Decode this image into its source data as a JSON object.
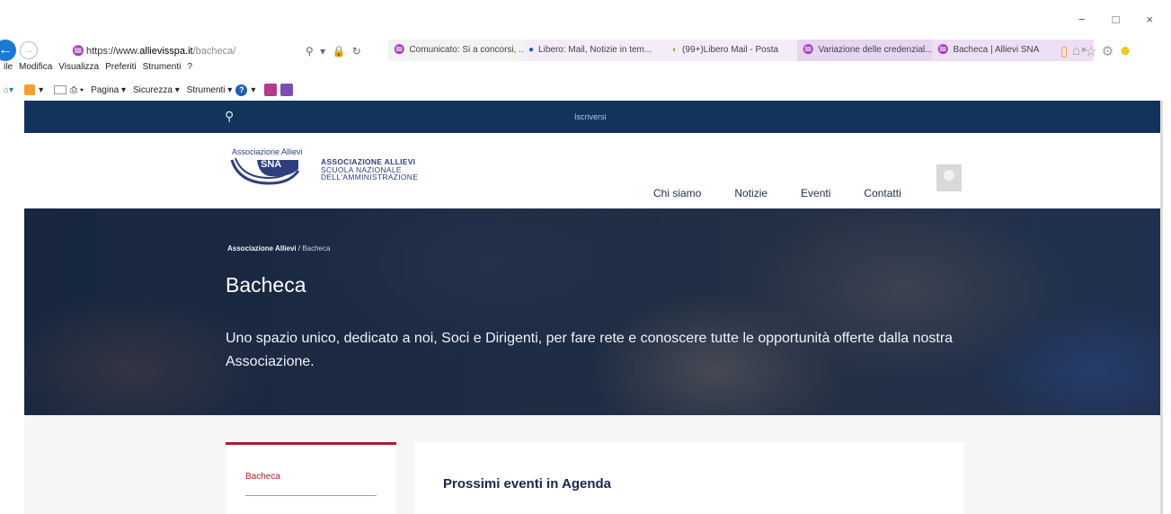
{
  "browser": {
    "address": {
      "prefix": "https://www.",
      "domain": "allievisspa.it",
      "path": "/bacheca/"
    },
    "address_tools": "⚲ ▾ 🔒 ↻",
    "tabs": [
      {
        "label": "Comunicato: Si a concorsi, ..."
      },
      {
        "label": "Libero: Mail, Notizie in tem..."
      },
      {
        "label": "(99+)Libero Mail - Posta"
      },
      {
        "label": "Variazione delle credenzial..."
      },
      {
        "label": "Bacheca | Allievi SNA"
      }
    ],
    "tab_close": "×",
    "menu": [
      "ile",
      "Modifica",
      "Visualizza",
      "Preferiti",
      "Strumenti",
      "?"
    ],
    "commands": [
      "Pagina ▾",
      "Sicurezza ▾",
      "Strumenti ▾"
    ],
    "window_controls": [
      "−",
      "□",
      "×"
    ],
    "right_icons": [
      "home-icon",
      "star-icon",
      "gear-icon",
      "smiley-icon"
    ]
  },
  "site": {
    "topbar": {
      "signup": "Iscriversi"
    },
    "logo": {
      "top_text": "Associazione Allievi",
      "badge": "SNA"
    },
    "org": {
      "line1": "ASSOCIAZIONE ALLIEVI",
      "line2": "SCUOLA NAZIONALE",
      "line3": "DELL'AMMINISTRAZIONE"
    },
    "nav": [
      "Chi siamo",
      "Notizie",
      "Eventi",
      "Contatti"
    ],
    "hero": {
      "breadcrumb_root": "Associazione Allievi",
      "breadcrumb_sep": " / ",
      "breadcrumb_current": "Bacheca",
      "title": "Bacheca",
      "description": "Uno spazio unico, dedicato a noi, Soci e Dirigenti, per fare rete e conoscere tutte le opportunità offerte dalla nostra Associazione."
    },
    "sidebar": {
      "items": [
        {
          "label": "Bacheca"
        }
      ]
    },
    "main": {
      "heading": "Prossimi eventi in Agenda"
    }
  },
  "colors": {
    "navy": "#12335c",
    "accent": "#a91f2b",
    "logo_blue": "#2f3e7e"
  }
}
